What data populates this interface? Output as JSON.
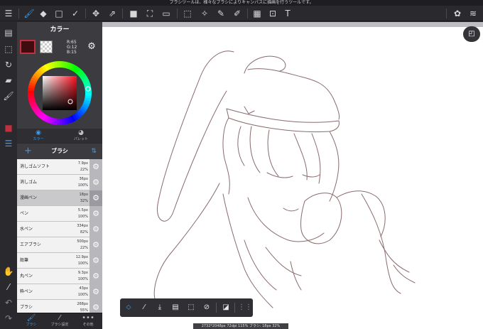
{
  "tooltip": "ブラシツールは、様々なブラシによりキャンバスに描画を行うツールです。",
  "toolbar": {
    "menu_icon": "☰",
    "brush_icon": "🖌",
    "eraser_icon": "◆",
    "rect_icon": "□",
    "smudge_icon": "✓",
    "move_icon": "✥",
    "transform_icon": "⇗",
    "fill_color_icon": "■",
    "bucket_icon": "⛶",
    "gradient_icon": "▭",
    "select_icon": "⬚",
    "magic_icon": "✧",
    "selectpen_icon": "✎",
    "selecteraser_icon": "✐",
    "frame_icon": "▦",
    "canvas_icon": "⊡",
    "text_icon": "T",
    "material_icon": "✿",
    "layers_icon": "≋"
  },
  "rail": {
    "r1": "▤",
    "r2": "⬚",
    "r3": "↻",
    "r4": "▰",
    "r5": "🖌",
    "r6": "■",
    "r7": "☰",
    "r8": "✋",
    "r9": "⁄",
    "r10": "↶",
    "r11": "↷"
  },
  "color_panel": {
    "title": "カラー",
    "r": "R:65",
    "g": "G:12",
    "b": "B:15",
    "gear_icon": "⚙",
    "current": "#410c0f",
    "tabs": [
      {
        "label": "カラー",
        "icon": "◉"
      },
      {
        "label": "パレット",
        "icon": "◕"
      }
    ]
  },
  "brush_panel": {
    "title": "ブラシ",
    "add_icon": "+",
    "sort_icon": "⇅",
    "gear_icon": "⚙",
    "brushes": [
      {
        "name": "消しゴムソフト",
        "size": "7.9px",
        "opacity": "22%"
      },
      {
        "name": "消しゴム",
        "size": "36px",
        "opacity": "100%"
      },
      {
        "name": "漫画ペン",
        "size": "18px",
        "opacity": "32%"
      },
      {
        "name": "ペン",
        "size": "5.5px",
        "opacity": "100%"
      },
      {
        "name": "水ペン",
        "size": "334px",
        "opacity": "82%"
      },
      {
        "name": "エアブラシ",
        "size": "500px",
        "opacity": "22%"
      },
      {
        "name": "鉛筆",
        "size": "12.9px",
        "opacity": "100%"
      },
      {
        "name": "丸ペン",
        "size": "9.3px",
        "opacity": "100%"
      },
      {
        "name": "粋ペン",
        "size": "43px",
        "opacity": "100%"
      },
      {
        "name": "ブラシ",
        "size": "268px",
        "opacity": "55%"
      }
    ],
    "tabs": [
      {
        "label": "ブラシ",
        "icon": "🖌"
      },
      {
        "label": "ブラシ設定",
        "icon": "⁄"
      },
      {
        "label": "その他",
        "icon": "•••"
      }
    ]
  },
  "floating_toolbar": {
    "i1": "⬦",
    "i2": "⁄",
    "i3": "⤓",
    "i4": "▤",
    "i5": "⬚",
    "i6": "⊘",
    "i7": "◪",
    "i8": "⋮⋮"
  },
  "nav_icon": "◰",
  "status": "2732*2048px 72dpi 115% ブラシ: 18px 32%",
  "accent": "#3a9df0"
}
